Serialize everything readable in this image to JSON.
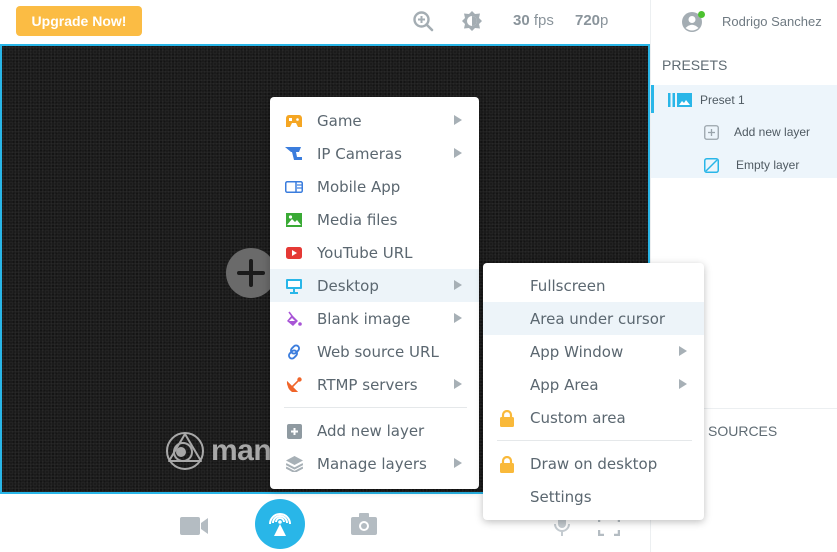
{
  "topbar": {
    "upgrade_label": "Upgrade Now!",
    "fps_value": "30",
    "fps_unit": "fps",
    "resolution_value": "720",
    "resolution_unit": "p"
  },
  "user": {
    "name": "Rodrigo Sanchez",
    "status": "online",
    "status_color": "#4cc22f"
  },
  "canvas": {
    "logo_text": "many",
    "accent_color": "#29b6e8"
  },
  "right_panel": {
    "presets_title": "PRESETS",
    "preset": {
      "label": "Preset 1",
      "layers": [
        {
          "label": "Add new layer",
          "icon": "add-square-icon"
        },
        {
          "label": "Empty layer",
          "icon": "empty-layer-icon"
        }
      ]
    },
    "sources_title": "SOURCES"
  },
  "main_menu": {
    "items": [
      {
        "label": "Game",
        "icon": "gamepad-icon",
        "color": "#f5a623",
        "submenu": true
      },
      {
        "label": "IP Cameras",
        "icon": "ip-camera-icon",
        "color": "#3b7ddd",
        "submenu": true
      },
      {
        "label": "Mobile App",
        "icon": "mobile-app-icon",
        "color": "#3b7ddd",
        "submenu": false
      },
      {
        "label": "Media files",
        "icon": "image-icon",
        "color": "#3aaa35",
        "submenu": false
      },
      {
        "label": "YouTube URL",
        "icon": "youtube-icon",
        "color": "#e53935",
        "submenu": false
      },
      {
        "label": "Desktop",
        "icon": "monitor-icon",
        "color": "#29b6e8",
        "submenu": true,
        "active": true
      },
      {
        "label": "Blank image",
        "icon": "paint-bucket-icon",
        "color": "#a855d6",
        "submenu": true
      },
      {
        "label": "Web source URL",
        "icon": "link-icon",
        "color": "#3b7ddd",
        "submenu": false
      },
      {
        "label": "RTMP servers",
        "icon": "satellite-dish-icon",
        "color": "#f0652a",
        "submenu": true
      }
    ],
    "footer_items": [
      {
        "label": "Add new layer",
        "icon": "add-square-icon",
        "color": "#8f9aa1",
        "submenu": false
      },
      {
        "label": "Manage layers",
        "icon": "layers-icon",
        "color": "#8f9aa1",
        "submenu": true
      }
    ]
  },
  "desktop_submenu": {
    "items": [
      {
        "label": "Fullscreen",
        "submenu": false,
        "locked": false
      },
      {
        "label": "Area under cursor",
        "submenu": false,
        "locked": false,
        "active": true
      },
      {
        "label": "App Window",
        "submenu": true,
        "locked": false
      },
      {
        "label": "App Area",
        "submenu": true,
        "locked": false
      },
      {
        "label": "Custom area",
        "submenu": false,
        "locked": true
      }
    ],
    "footer_items": [
      {
        "label": "Draw on desktop",
        "submenu": false,
        "locked": true
      },
      {
        "label": "Settings",
        "submenu": false,
        "locked": false
      }
    ],
    "lock_color": "#f9b93a"
  }
}
